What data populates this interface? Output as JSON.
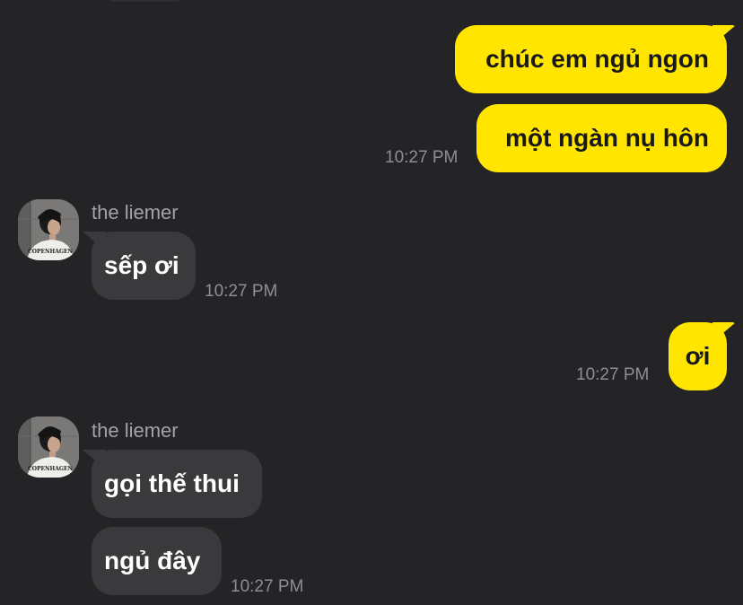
{
  "messages": [
    {
      "direction": "outgoing",
      "text": "chúc em ngủ ngon"
    },
    {
      "direction": "outgoing",
      "text": "một ngàn nụ hôn",
      "time": "10:27 PM"
    },
    {
      "direction": "incoming",
      "sender": "the liemer",
      "text": "sếp ơi",
      "time": "10:27 PM"
    },
    {
      "direction": "outgoing",
      "text": "ơi",
      "time": "10:27 PM"
    },
    {
      "direction": "incoming",
      "sender": "the liemer",
      "text": "gọi thế thui"
    },
    {
      "direction": "incoming",
      "text": "ngủ đây",
      "time": "10:27 PM"
    }
  ],
  "avatar": {
    "icon": "user-avatar-photo",
    "shirt_text": "COPENHAGEN"
  },
  "colors": {
    "background": "#242426",
    "outgoing_bubble": "#ffe500",
    "incoming_bubble": "#3a3a3c",
    "timestamp": "#8e8e93",
    "sender_name": "#a3a3a8"
  }
}
